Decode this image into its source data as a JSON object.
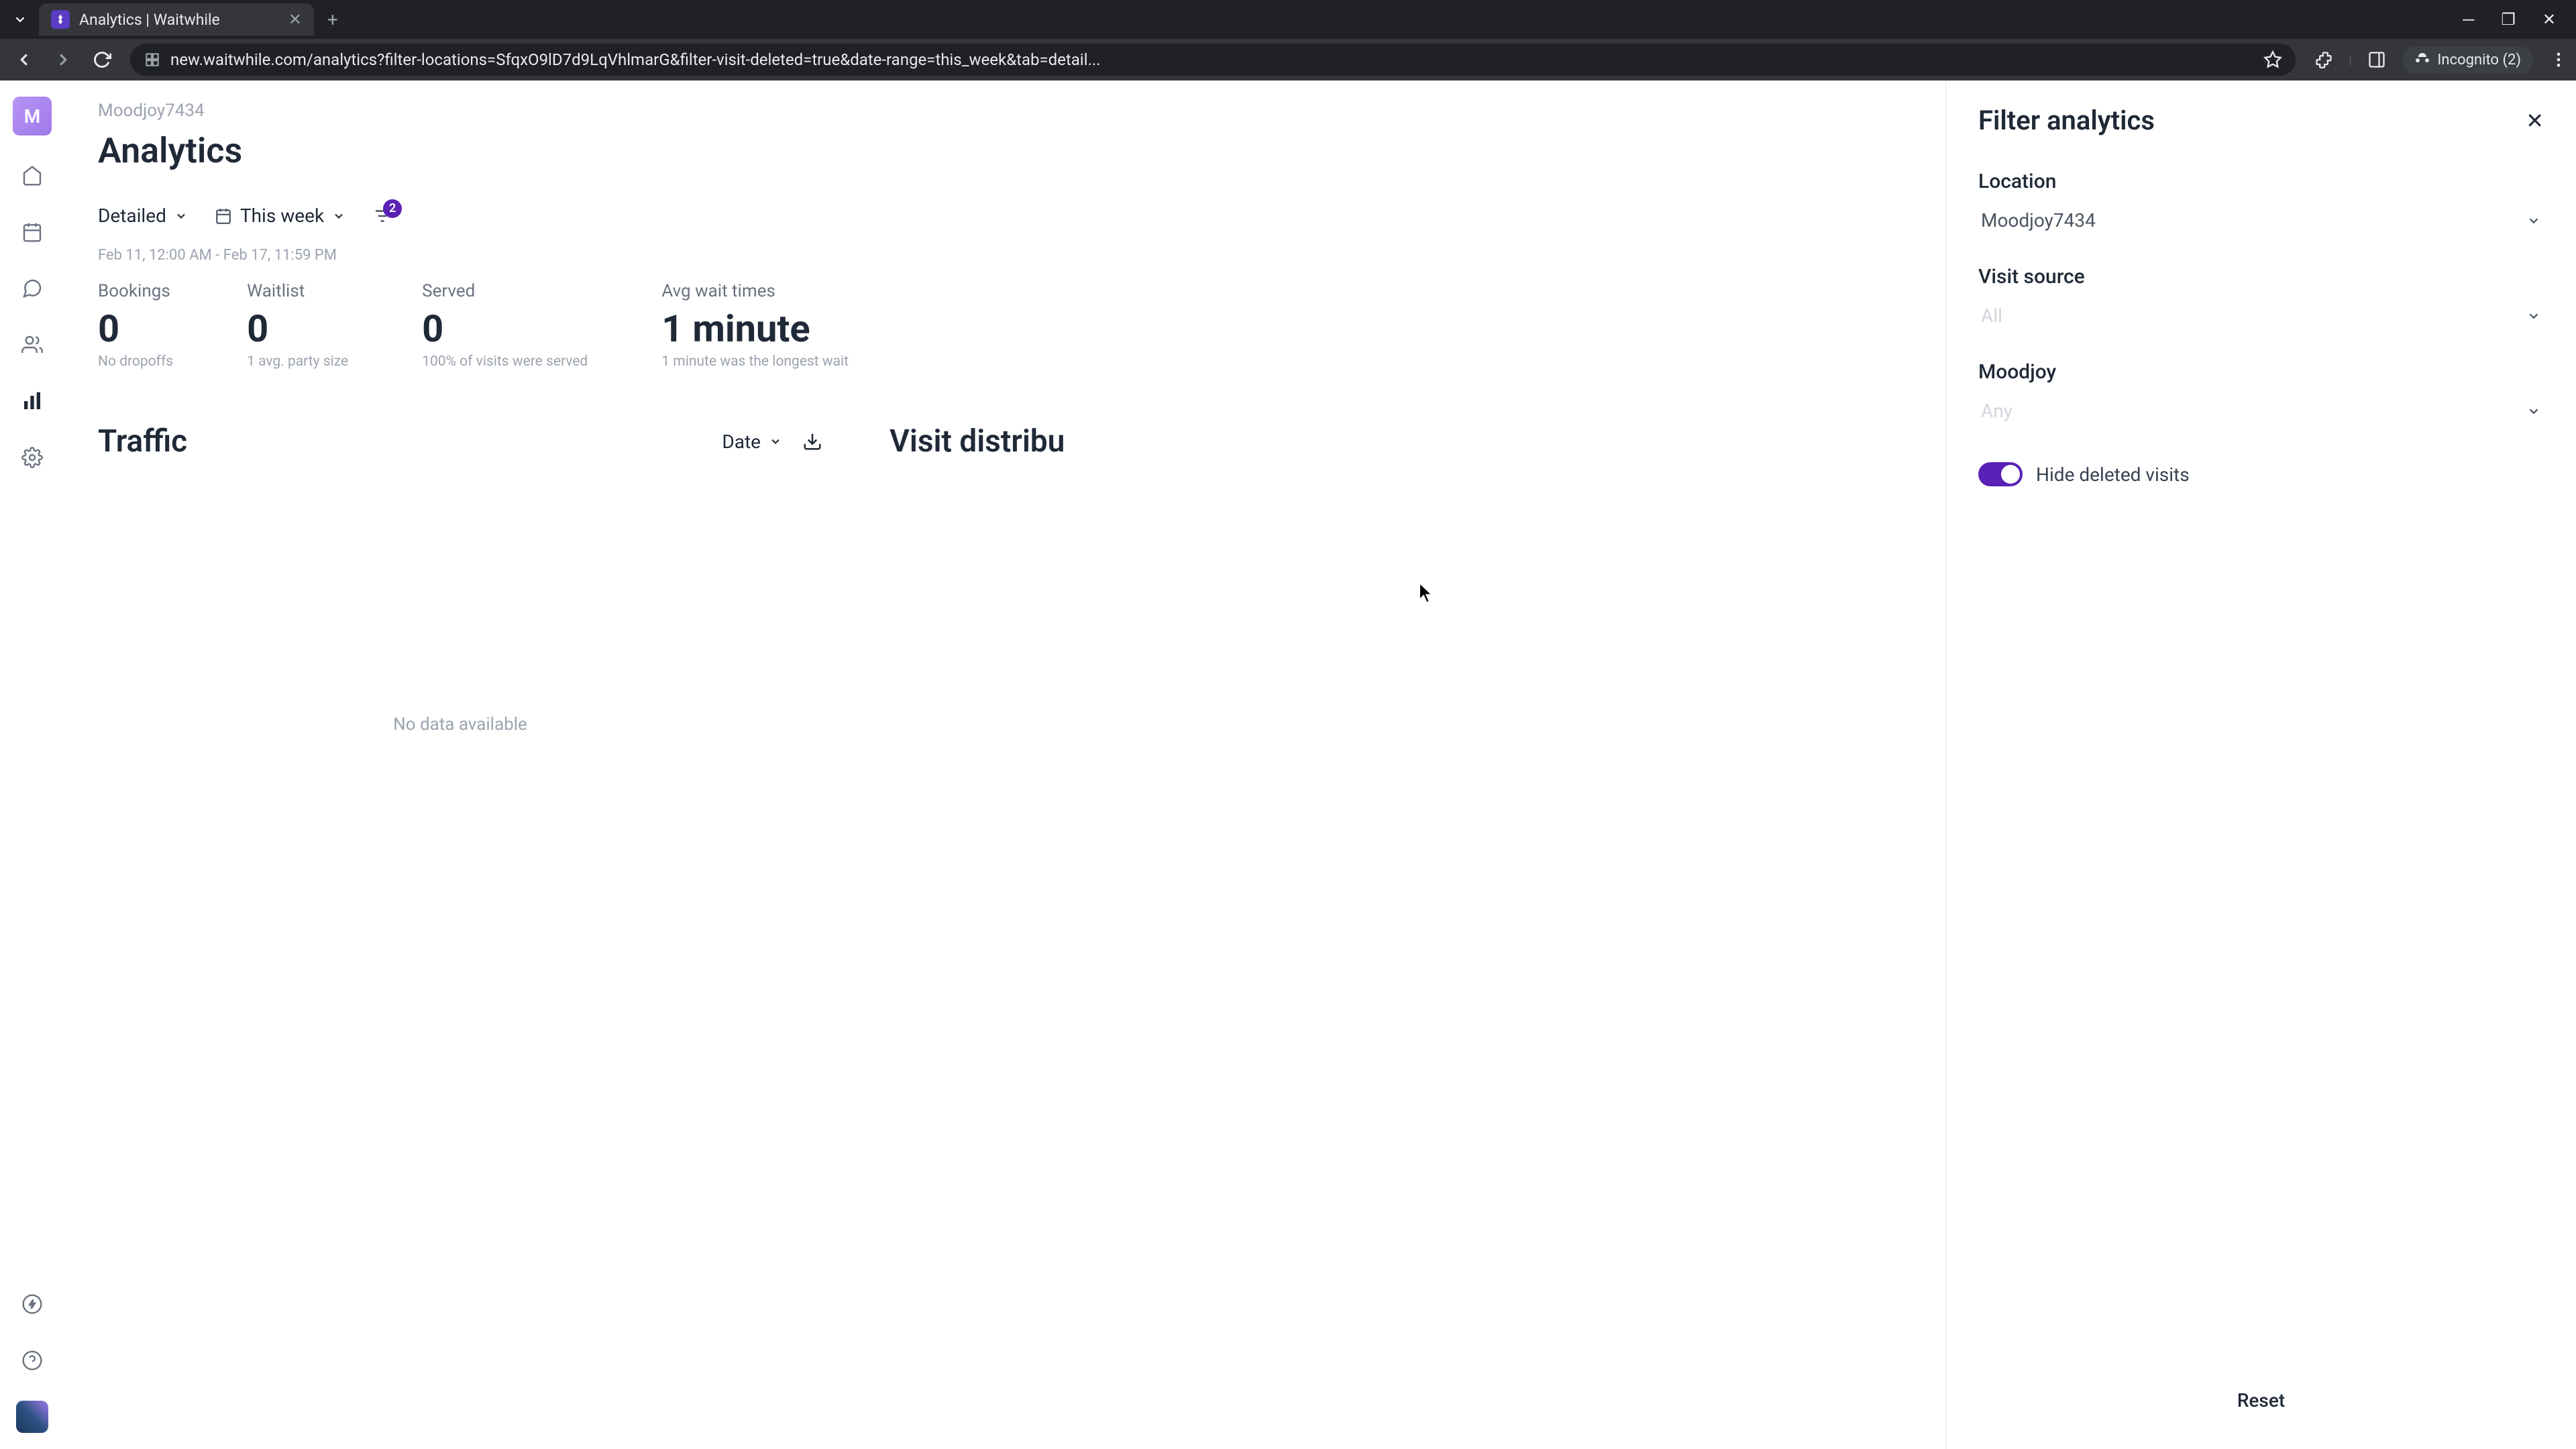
{
  "browser": {
    "tab_title": "Analytics | Waitwhile",
    "url": "new.waitwhile.com/analytics?filter-locations=SfqxO9lD7d9LqVhlmarG&filter-visit-deleted=true&date-range=this_week&tab=detail...",
    "incognito": "Incognito (2)"
  },
  "sidebar": {
    "logo_letter": "M"
  },
  "breadcrumb": "Moodjoy7434",
  "page_title": "Analytics",
  "toolbar": {
    "view_mode": "Detailed",
    "date_range": "This week",
    "filter_count": "2"
  },
  "date_range_text": "Feb 11, 12:00 AM - Feb 17, 11:59 PM",
  "stats": [
    {
      "label": "Bookings",
      "value": "0",
      "sub": "No dropoffs"
    },
    {
      "label": "Waitlist",
      "value": "0",
      "sub": "1 avg. party size"
    },
    {
      "label": "Served",
      "value": "0",
      "sub": "100% of visits were served"
    },
    {
      "label": "Avg wait times",
      "value": "1 minute",
      "sub": "1 minute was the longest wait"
    }
  ],
  "traffic": {
    "title": "Traffic",
    "group_by": "Date",
    "no_data": "No data available"
  },
  "visit_dist": {
    "title": "Visit distribu"
  },
  "filter_panel": {
    "title": "Filter analytics",
    "location_label": "Location",
    "location_value": "Moodjoy7434",
    "visit_source_label": "Visit source",
    "visit_source_value": "All",
    "custom_label": "Moodjoy",
    "custom_value": "Any",
    "hide_deleted": "Hide deleted visits",
    "reset": "Reset"
  }
}
